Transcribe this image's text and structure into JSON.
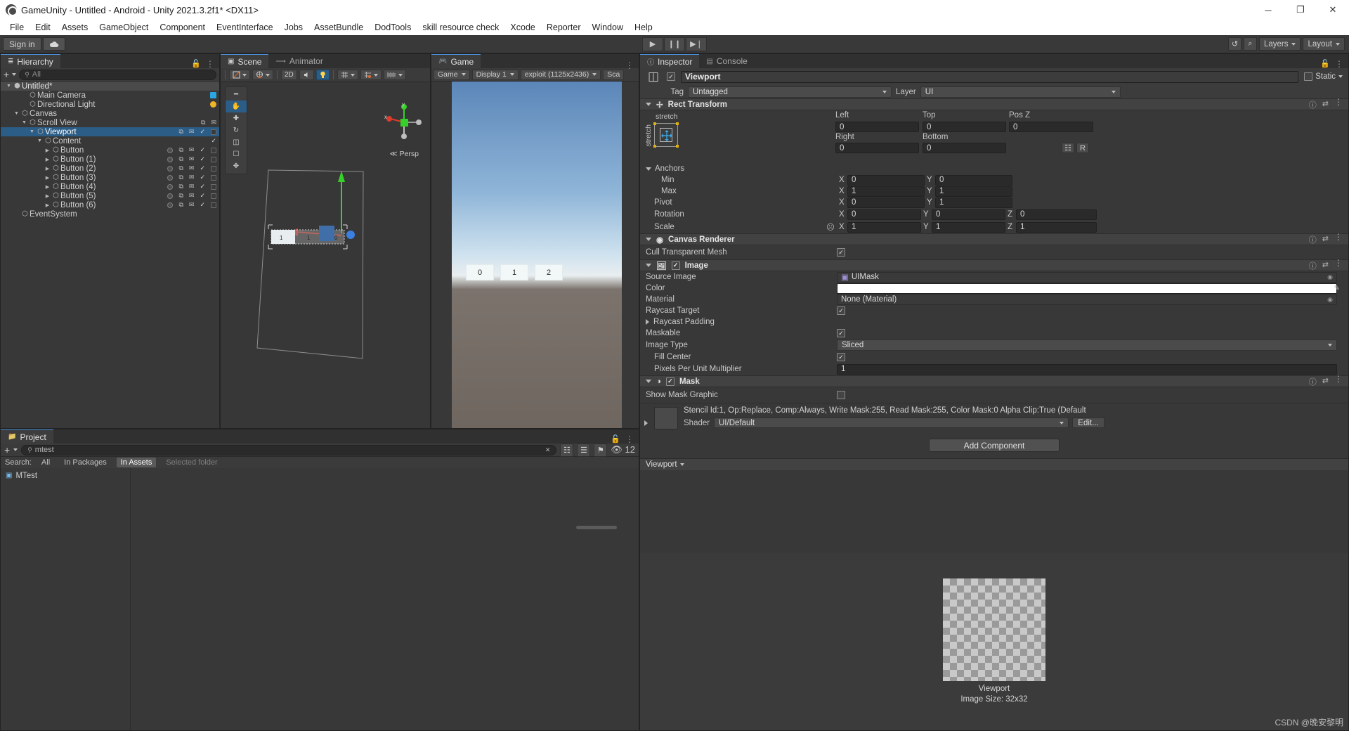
{
  "window": {
    "title": "GameUnity - Untitled - Android - Unity 2021.3.2f1* <DX11>",
    "minimize": "─",
    "maximize": "❐",
    "close": "✕",
    "app_icon": "unity-logo-icon"
  },
  "menubar": {
    "items": [
      "File",
      "Edit",
      "Assets",
      "GameObject",
      "Component",
      "EventInterface",
      "Jobs",
      "AssetBundle",
      "DodTools",
      "skill resource check",
      "Xcode",
      "Reporter",
      "Window",
      "Help"
    ]
  },
  "toolbar": {
    "signin_label": "Sign in",
    "cloud_icon": "cloud-icon",
    "play": "▶",
    "pause": "❙❙",
    "step": "▶❘",
    "history_icon": "↺",
    "search_icon": "⌕",
    "layers_label": "Layers",
    "layout_label": "Layout"
  },
  "hierarchy": {
    "tab": "Hierarchy",
    "tab_icon": "hierarchy-icon",
    "add_label": "+",
    "search_placeholder": "All",
    "tree": [
      {
        "label": "Untitled*",
        "depth": 0,
        "arrow": "down",
        "icon": "scene-icon",
        "kind": "scene"
      },
      {
        "label": "Main Camera",
        "depth": 2,
        "arrow": "none",
        "icon": "gameobject-icon",
        "badge": "camera"
      },
      {
        "label": "Directional Light",
        "depth": 2,
        "arrow": "none",
        "icon": "gameobject-icon",
        "badge": "light"
      },
      {
        "label": "Canvas",
        "depth": 1,
        "arrow": "down",
        "icon": "gameobject-icon"
      },
      {
        "label": "Scroll View",
        "depth": 2,
        "arrow": "down",
        "icon": "gameobject-icon",
        "icons": [
          "layers",
          "bone"
        ]
      },
      {
        "label": "Viewport",
        "depth": 3,
        "arrow": "down",
        "icon": "gameobject-icon",
        "selected": true,
        "icons": [
          "layers",
          "bone",
          "check",
          "box"
        ]
      },
      {
        "label": "Content",
        "depth": 4,
        "arrow": "down",
        "icon": "gameobject-icon",
        "icons": [
          "check"
        ]
      },
      {
        "label": "Button",
        "depth": 5,
        "arrow": "right",
        "icon": "gameobject-icon",
        "icons": [
          "dot",
          "layers",
          "bone",
          "check",
          "box"
        ]
      },
      {
        "label": "Button (1)",
        "depth": 5,
        "arrow": "right",
        "icon": "gameobject-icon",
        "icons": [
          "dot",
          "layers",
          "bone",
          "check",
          "box"
        ]
      },
      {
        "label": "Button (2)",
        "depth": 5,
        "arrow": "right",
        "icon": "gameobject-icon",
        "icons": [
          "dot",
          "layers",
          "bone",
          "check",
          "box"
        ]
      },
      {
        "label": "Button (3)",
        "depth": 5,
        "arrow": "right",
        "icon": "gameobject-icon",
        "icons": [
          "dot",
          "layers",
          "bone",
          "check",
          "box"
        ]
      },
      {
        "label": "Button (4)",
        "depth": 5,
        "arrow": "right",
        "icon": "gameobject-icon",
        "icons": [
          "dot",
          "layers",
          "bone",
          "check",
          "box"
        ]
      },
      {
        "label": "Button (5)",
        "depth": 5,
        "arrow": "right",
        "icon": "gameobject-icon",
        "icons": [
          "dot",
          "layers",
          "bone",
          "check",
          "box"
        ]
      },
      {
        "label": "Button (6)",
        "depth": 5,
        "arrow": "right",
        "icon": "gameobject-icon",
        "icons": [
          "dot",
          "layers",
          "bone",
          "check",
          "box"
        ]
      },
      {
        "label": "EventSystem",
        "depth": 1,
        "arrow": "none",
        "icon": "gameobject-icon"
      }
    ]
  },
  "scene": {
    "tabs": [
      {
        "label": "Scene",
        "icon": "scene-grid-icon",
        "active": true
      },
      {
        "label": "Animator",
        "icon": "animator-icon",
        "active": false
      }
    ],
    "toolbar": {
      "draw_mode": "shaded-icon",
      "lighting": "globe-icon",
      "twod_label": "2D",
      "audio_icon": "audio-icon",
      "effects_icon": "effects-icon",
      "gizmos_icon": "gizmos-icon",
      "grid_icon": "grid-icon",
      "view_icon": "view-options-icon"
    },
    "view_tools": [
      "hand-tool",
      "move-tool",
      "rotate-tool",
      "scale-tool",
      "rect-tool",
      "transform-tool"
    ],
    "gizmo": {
      "x": "x",
      "y": "y",
      "z": "z",
      "mode": "Persp"
    }
  },
  "game": {
    "tab": "Game",
    "tab_icon": "gamepad-icon",
    "menu_label": "Game",
    "display_label": "Display 1",
    "resolution_label": "exploit (1125x2436)",
    "scale_label": "Sca",
    "buttons": [
      "0",
      "1",
      "2"
    ]
  },
  "project": {
    "tab": "Project",
    "tab_icon": "folder-icon",
    "add_label": "+",
    "search_value": "mtest",
    "search_icon": "search-icon",
    "clear_icon": "✕",
    "count_badge": "12",
    "search_row_label": "Search:",
    "filters": [
      {
        "label": "All",
        "active": false
      },
      {
        "label": "In Packages",
        "active": false
      },
      {
        "label": "In Assets",
        "active": true
      },
      {
        "label": "Selected folder",
        "active": false
      }
    ],
    "results": [
      {
        "label": "MTest",
        "icon": "script-icon"
      }
    ]
  },
  "inspector": {
    "tabs": [
      {
        "label": "Inspector",
        "icon": "info-icon",
        "active": true
      },
      {
        "label": "Console",
        "icon": "console-icon",
        "active": false
      }
    ],
    "gameobject": {
      "icon": "cube-icon",
      "enabled": true,
      "name": "Viewport",
      "static_label": "Static",
      "tag_label": "Tag",
      "tag_value": "Untagged",
      "layer_label": "Layer",
      "layer_value": "UI"
    },
    "rect_transform": {
      "title": "Rect Transform",
      "icon": "rect-transform-icon",
      "anchor_preset_h": "stretch",
      "anchor_preset_v": "stretch",
      "left_label": "Left",
      "left_value": "0",
      "top_label": "Top",
      "top_value": "0",
      "posz_label": "Pos Z",
      "posz_value": "0",
      "right_label": "Right",
      "right_value": "0",
      "bottom_label": "Bottom",
      "bottom_value": "0",
      "blueprint_icon": "blueprint-mode-icon",
      "raw_icon": "R",
      "anchors_label": "Anchors",
      "min_label": "Min",
      "min_x": "0",
      "min_y": "0",
      "max_label": "Max",
      "max_x": "1",
      "max_y": "1",
      "pivot_label": "Pivot",
      "pivot_x": "0",
      "pivot_y": "1",
      "rotation_label": "Rotation",
      "rot_x": "0",
      "rot_y": "0",
      "rot_z": "0",
      "scale_label": "Scale",
      "scale_x": "1",
      "scale_y": "1",
      "scale_z": "1",
      "axis_x": "X",
      "axis_y": "Y",
      "axis_z": "Z",
      "link_icon": "link-off-icon"
    },
    "canvas_renderer": {
      "title": "Canvas Renderer",
      "icon": "canvas-renderer-icon",
      "cull_label": "Cull Transparent Mesh",
      "cull_checked": true
    },
    "image": {
      "title": "Image",
      "icon": "image-icon",
      "enabled": true,
      "source_image_label": "Source Image",
      "source_image_value": "UIMask",
      "color_label": "Color",
      "color_value": "#FFFFFF",
      "material_label": "Material",
      "material_value": "None (Material)",
      "raycast_target_label": "Raycast Target",
      "raycast_target_checked": true,
      "raycast_padding_label": "Raycast Padding",
      "maskable_label": "Maskable",
      "maskable_checked": true,
      "image_type_label": "Image Type",
      "image_type_value": "Sliced",
      "fill_center_label": "Fill Center",
      "fill_center_checked": true,
      "ppu_label": "Pixels Per Unit Multiplier",
      "ppu_value": "1"
    },
    "mask": {
      "title": "Mask",
      "icon": "mask-icon",
      "enabled": true,
      "show_mask_graphic_label": "Show Mask Graphic",
      "show_mask_graphic_checked": false,
      "stencil_info": "Stencil Id:1, Op:Replace, Comp:Always, Write Mask:255, Read Mask:255, Color Mask:0 Alpha Clip:True (Default",
      "shader_label": "Shader",
      "shader_value": "UI/Default",
      "edit_label": "Edit..."
    },
    "add_component_label": "Add Component",
    "preview": {
      "title": "Viewport",
      "name": "Viewport",
      "image_size": "Image Size: 32x32"
    }
  },
  "watermark": "CSDN @晚安黎明",
  "colors": {
    "selection_blue": "#2c5d87",
    "tab_accent": "#4c90d9",
    "panel_bg": "#383838",
    "header_bg": "#3b3b3b"
  }
}
